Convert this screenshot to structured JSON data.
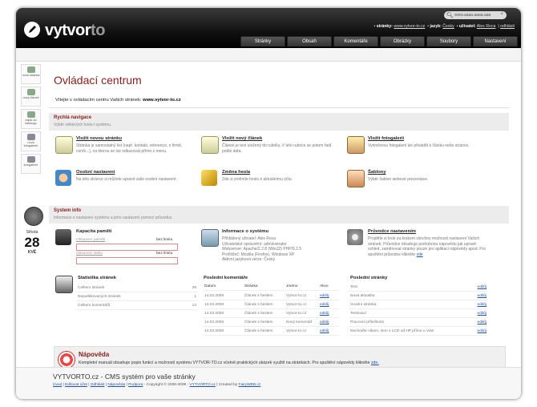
{
  "header": {
    "logo_main": "vytvor",
    "logo_accent": "to",
    "search_placeholder": "www.aaaa.aaaa.aaa",
    "userbar": {
      "pages_label": "stránky:",
      "pages_value": "www.vytvor-to.cz",
      "lang_label": "jazyk:",
      "lang_value": "Česky",
      "user_label": "uživatel:",
      "user_value": "Ales Roca",
      "logout": "odhlásit"
    },
    "tabs": [
      "Stránky",
      "Obsah",
      "Komentáře",
      "Obrázky",
      "Soubory",
      "Nastavení"
    ]
  },
  "sidebar": {
    "items": [
      "nová stránka",
      "nový článek",
      "zápis do katalogu",
      "nová fotogalerie",
      "fotogalerie"
    ],
    "day_name": "Středa",
    "day_number": "28",
    "month": "KVĚ"
  },
  "main": {
    "title": "Ovládací centrum",
    "welcome_text": "Vítejte v ovládacím centru Vašich stránek:",
    "welcome_site": "www.vytvor-to.cz",
    "quick_nav": {
      "title": "Rychlá navigace",
      "subtitle": "Výběr některých funkcí systému."
    },
    "features": [
      {
        "title": "Vložit novou stránku",
        "desc": "Stránka je samostatný list (např. kontakt, reference, o firmě, ceník...), na kterou se lze odkazovat přímo z menu."
      },
      {
        "title": "Vložit nový článek",
        "desc": "Článek je text uložený do rubriky. V této rubrice se potom řadí podle data."
      },
      {
        "title": "Vložit fotogalerii",
        "desc": "Vytvořenou fotogalerii lze přivádět k článku nebo stránce."
      },
      {
        "title": "Osobní nastavení",
        "desc": "Na této stránce si můžete upravit vaše osobní nastavení."
      },
      {
        "title": "Změna hesla",
        "desc": "Zde si změníte heslo k aktuálnímu účtu."
      },
      {
        "title": "Šablony",
        "desc": "Výběr šablon webové prezentace."
      }
    ],
    "system_info": {
      "title": "System info",
      "subtitle": "Informace o nastavení systému a jeho nastavení pomocí průvodce."
    },
    "memory": {
      "title": "Kapacita paměti",
      "rows": [
        {
          "label": "Obsazení paměti",
          "value": "bez limitu"
        },
        {
          "label": "Obsazení disku",
          "value": "bez limitu"
        }
      ]
    },
    "sysinfo": {
      "title": "Informace o systému",
      "lines": [
        "Přihlášený uživatel: Ales Roca",
        "Uživatelské oprávnění: administrator",
        "Webserver: Apache/2.2.8 (Win32) PHP/5.2.5",
        "Prohlížeč: Mozilla (Firefox), Windows XP",
        "Aktivní jazyková verze: Česky"
      ]
    },
    "wizard": {
      "title": "Průvodce nastavením",
      "desc": "Projděte si krok za krokem všechny možnosti nastavení Vašich stránek. Průvodce obsahuje podrobnou nápovědu jak upravit vzhled, zaměnovat stránky pouze pro aplikaci nápovědy apod. Pro spuštění průvodce klikněte",
      "link": "zde"
    },
    "stats": {
      "title": "Statistika stránek",
      "rows": [
        {
          "label": "Celkem stránek",
          "value": "26"
        },
        {
          "label": "Nepublikovaných stránek",
          "value": "1"
        },
        {
          "label": "Celkem komentářů",
          "value": "14"
        }
      ]
    },
    "comments": {
      "title": "Poslední komentáře",
      "headers": [
        "Datum",
        "Stránka",
        "Jméno",
        "Akce"
      ],
      "rows": [
        {
          "date": "14.03.2008",
          "page": "Článek s heslem",
          "name": "Vytvor-to.cz",
          "action": "editůj"
        },
        {
          "date": "14.03.2008",
          "page": "Článek s heslem",
          "name": "Vytvor-to.cz",
          "action": "editůj"
        },
        {
          "date": "14.03.2008",
          "page": "Článek s heslem",
          "name": "Vytvor-to.cz",
          "action": "editůj"
        },
        {
          "date": "14.03.2008",
          "page": "Článek s heslem",
          "name": "Nový komentář",
          "action": "editůj"
        },
        {
          "date": "14.03.2008",
          "page": "Článek s heslem",
          "name": "Vytvor-to.cz",
          "action": "editůj"
        }
      ]
    },
    "last_pages": {
      "title": "Poslední stránky",
      "rows": [
        {
          "name": "Test",
          "action": "editůj"
        },
        {
          "name": "Nová aktualita",
          "action": "editůj"
        },
        {
          "name": "Úvodní stránka",
          "action": "editůj"
        },
        {
          "name": "Testovací",
          "action": "editůj"
        },
        {
          "name": "Pracovní příležitosti",
          "action": "editůj"
        },
        {
          "name": "Nechoďte nikam, sem s LCD od HP přímo u Vás!",
          "action": "editůj"
        }
      ]
    },
    "help": {
      "title": "Nápověda",
      "desc": "Kompletní manuál obsahuje popis funkcí a možností systému VYTVOR-TO.cz včetně praktických ukázek využití na stránkách. Pro spuštění nápovědy klikněte",
      "link": "zde."
    }
  },
  "footer": {
    "title": "VYTVORTO.cz - CMS systém pro vaše stránky",
    "links": [
      "Úvod",
      "Editovat účet",
      "Odhlásit",
      "Nápověda",
      "Podpora"
    ],
    "copyright": "Copyright © 2006-2008 -",
    "copyright_link": "VYTVORTO.cz",
    "created_by": "| Created by",
    "created_link": "FairyWEB.cz"
  }
}
